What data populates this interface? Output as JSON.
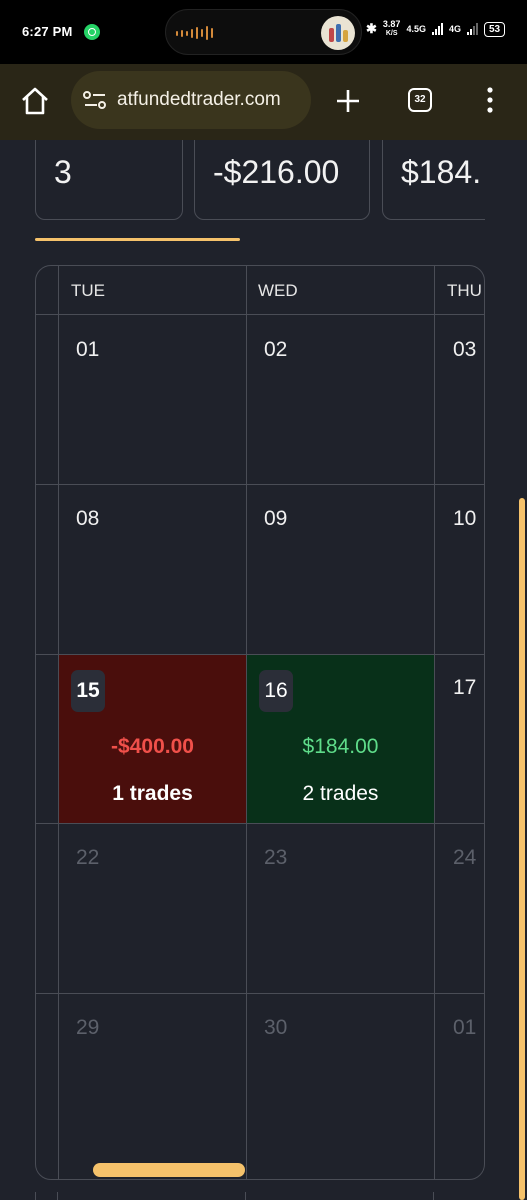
{
  "status_bar": {
    "time": "6:27 PM",
    "speed_value": "3.87",
    "speed_unit": "K/S",
    "network_1": "4.5G",
    "network_2": "4G",
    "battery": "53"
  },
  "browser": {
    "url": "atfundedtrader.com",
    "tab_count": "32",
    "icons": [
      "home-icon",
      "site-settings-icon",
      "new-tab-plus-icon",
      "tab-switcher-icon",
      "more-menu-icon"
    ]
  },
  "summary": {
    "cards": [
      "3",
      "-$216.00",
      "$184."
    ]
  },
  "calendar": {
    "day_headers": [
      "TUE",
      "WED",
      "THU"
    ],
    "weeks": [
      {
        "days": [
          "01",
          "02",
          "03"
        ]
      },
      {
        "days": [
          "08",
          "09",
          "10"
        ]
      },
      {
        "days": [
          "15",
          "16",
          "17"
        ]
      },
      {
        "days": [
          "22",
          "23",
          "24"
        ]
      },
      {
        "days": [
          "29",
          "30",
          "01"
        ]
      }
    ],
    "day_15": {
      "pnl": "-$400.00",
      "trades": "1 trades"
    },
    "day_16": {
      "pnl": "$184.00",
      "trades": "2 trades"
    }
  },
  "colors": {
    "accent": "#f5c26b",
    "loss_bg": "#4a0e0c",
    "loss_text": "#f0504a",
    "gain_bg": "#083019",
    "gain_text": "#5fdc8a",
    "background": "#1f222b"
  }
}
